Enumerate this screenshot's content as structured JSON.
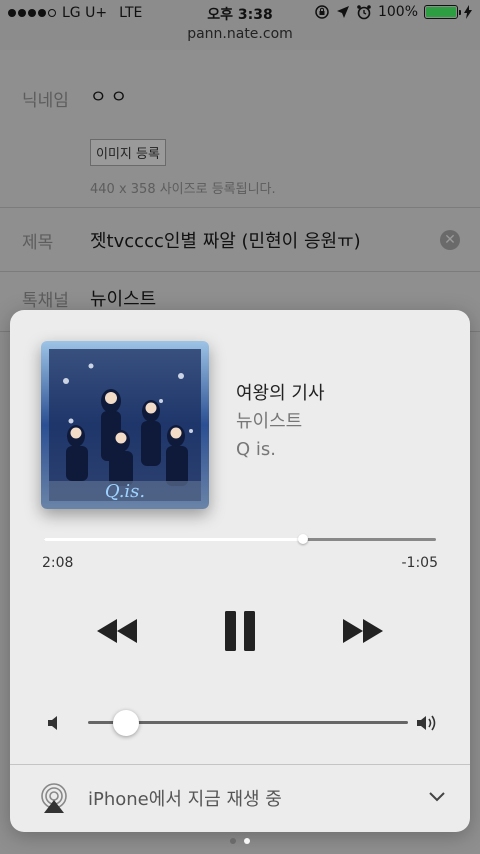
{
  "status": {
    "carrier": "LG U+",
    "network": "LTE",
    "time": "오후 3:38",
    "battery": "100%",
    "battery_color": "#2e9e43"
  },
  "browser": {
    "url": "pann.nate.com"
  },
  "form": {
    "nickname_label": "닉네임",
    "nickname_value": "ㅇㅇ",
    "image_button": "이미지 등록",
    "image_hint": "440 x 358 사이즈로 등록됩니다.",
    "title_label": "제목",
    "title_value": "젯tvcccc인별 짜알 (민현이 응원ㅠ)",
    "channel_label": "톡채널",
    "channel_value": "뉴이스트"
  },
  "now_playing": {
    "song": "여왕의 기사",
    "artist": "뉴이스트",
    "album": "Q is.",
    "album_art_text": "Q.is.",
    "elapsed": "2:08",
    "remaining": "-1:05",
    "progress_fraction": 0.66,
    "volume_fraction": 0.12,
    "output_label": "iPhone에서 지금 재생 중"
  },
  "pager": {
    "pages": 2,
    "current": 2
  }
}
